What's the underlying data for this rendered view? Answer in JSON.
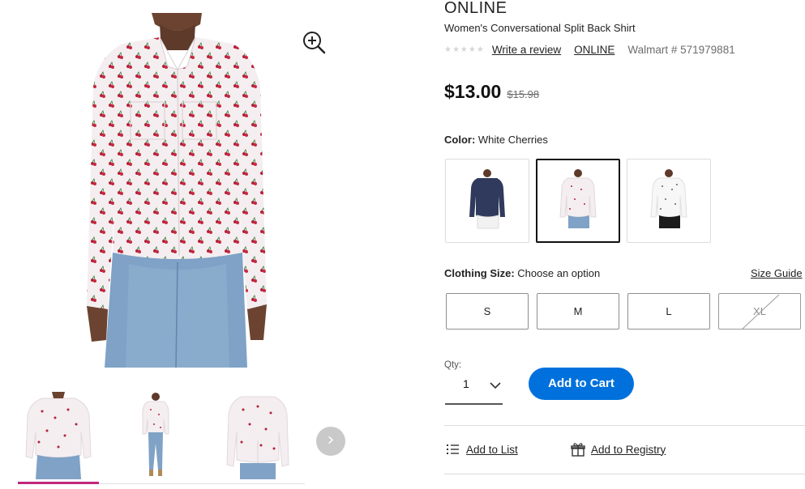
{
  "product": {
    "brand": "ONLINE",
    "title": "Women's Conversational Split Back Shirt",
    "rating_stars": "★★★★★",
    "review_link": "Write a review",
    "brand_link": "ONLINE",
    "item_number": "Walmart # 571979881"
  },
  "price": {
    "current": "$13.00",
    "was": "$15.98"
  },
  "color": {
    "label": "Color:",
    "selected": "White Cherries",
    "swatches": [
      {
        "name": "Navy",
        "shirt_color": "#2f3a5c",
        "pants_color": "#f2f2f2"
      },
      {
        "name": "White Cherries",
        "shirt_color": "#f4eef0",
        "pants_color": "#7fa2c6",
        "selected": true
      },
      {
        "name": "White Dots",
        "shirt_color": "#f7f7f7",
        "pants_color": "#1b1b1b"
      }
    ]
  },
  "size": {
    "label": "Clothing Size:",
    "prompt": "Choose an option",
    "guide_link": "Size Guide",
    "options": [
      {
        "label": "S",
        "available": true
      },
      {
        "label": "M",
        "available": true
      },
      {
        "label": "L",
        "available": true
      },
      {
        "label": "XL",
        "available": false
      }
    ]
  },
  "quantity": {
    "label": "Qty:",
    "value": "1"
  },
  "actions": {
    "add_to_cart": "Add to Cart",
    "add_to_list": "Add to List",
    "add_to_registry": "Add to Registry"
  },
  "gallery": {
    "next_arrow": "›",
    "icons": {
      "zoom": "zoom-in-icon",
      "next": "chevron-right-icon",
      "list": "list-icon",
      "registry": "gift-icon"
    },
    "active_thumb_color": "#c0267a"
  },
  "colors": {
    "accent": "#0071dc",
    "text": "#222222",
    "muted": "#6d6d6d",
    "cherry": "#b4203a"
  }
}
